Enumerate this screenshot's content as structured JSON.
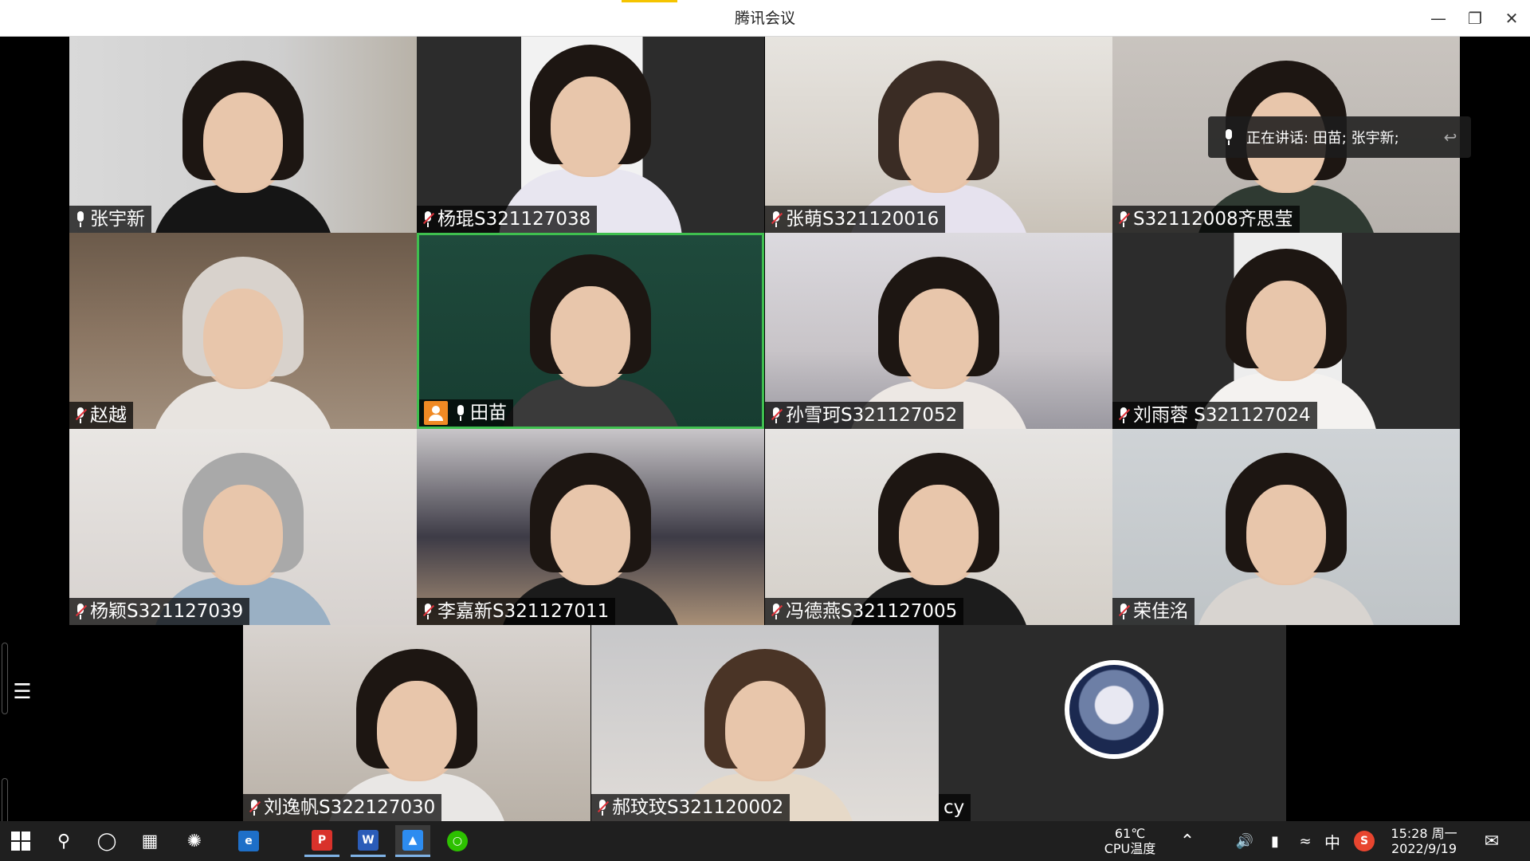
{
  "window": {
    "title": "腾讯会议",
    "minimize_icon": "minimize-icon",
    "maximize_icon": "restore-icon",
    "close_icon": "close-icon"
  },
  "speaking_banner": {
    "text": "正在讲话: 田苗; 张宇新;",
    "icon": "mic-icon"
  },
  "participants": [
    {
      "name": "张宇新",
      "muted": false,
      "host": false
    },
    {
      "name": "杨琨S321127038",
      "muted": true,
      "host": false
    },
    {
      "name": "张萌S321120016",
      "muted": true,
      "host": false
    },
    {
      "name": "S32112008齐思莹",
      "muted": true,
      "host": false
    },
    {
      "name": "赵越",
      "muted": true,
      "host": false
    },
    {
      "name": "田苗",
      "muted": false,
      "host": true
    },
    {
      "name": "孙雪珂S321127052",
      "muted": true,
      "host": false
    },
    {
      "name": "刘雨蓉 S321127024",
      "muted": true,
      "host": false
    },
    {
      "name": "杨颖S321127039",
      "muted": true,
      "host": false
    },
    {
      "name": "李嘉新S321127011",
      "muted": true,
      "host": false
    },
    {
      "name": "冯德燕S321127005",
      "muted": true,
      "host": false
    },
    {
      "name": "荣佳洺",
      "muted": true,
      "host": false
    },
    {
      "name": "刘逸帆S322127030",
      "muted": true,
      "host": false
    },
    {
      "name": "郝玟玟S321120002",
      "muted": true,
      "host": false
    },
    {
      "name": "cy",
      "muted": false,
      "host": false
    }
  ],
  "taskbar": {
    "temp": "61℃",
    "temp_label": "CPU温度",
    "ime": "中",
    "time": "15:28 周一",
    "date": "2022/9/19"
  }
}
